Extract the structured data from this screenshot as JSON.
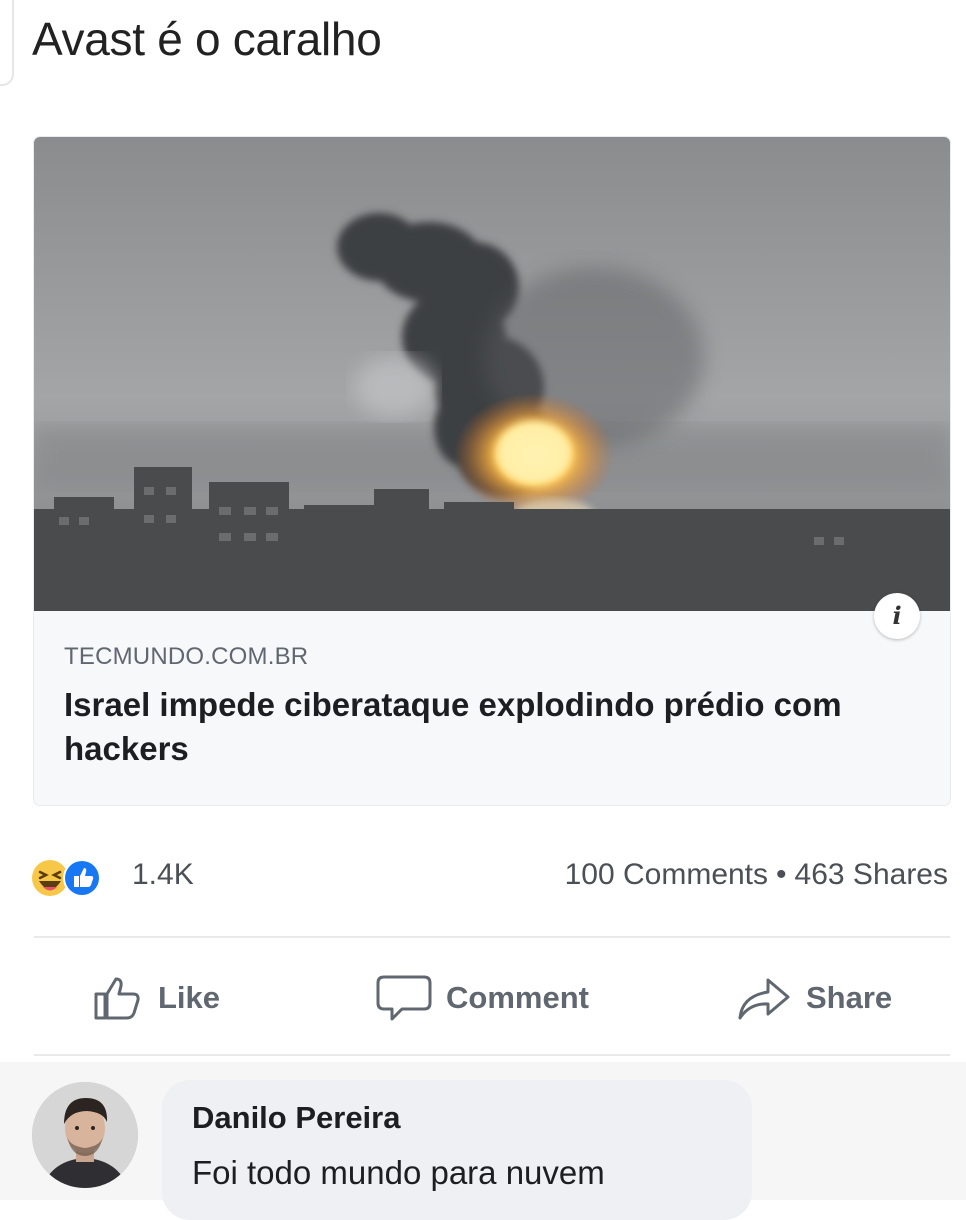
{
  "post": {
    "text": "Avast é o caralho"
  },
  "link_card": {
    "domain": "TECMUNDO.COM.BR",
    "title": "Israel impede ciberataque explodindo prédio com hackers",
    "info_icon": "i"
  },
  "reactions": {
    "icons": [
      "haha-reaction-icon",
      "like-reaction-icon"
    ],
    "count": "1.4K",
    "comments": "100 Comments",
    "separator": "•",
    "shares": "463 Shares"
  },
  "actions": {
    "like": "Like",
    "comment": "Comment",
    "share": "Share"
  },
  "comment": {
    "author": "Danilo Pereira",
    "text": "Foi todo mundo para nuvem"
  },
  "colors": {
    "like_blue": "#1877f2",
    "haha_yellow": "#f7c748",
    "action_gray": "#606770"
  }
}
